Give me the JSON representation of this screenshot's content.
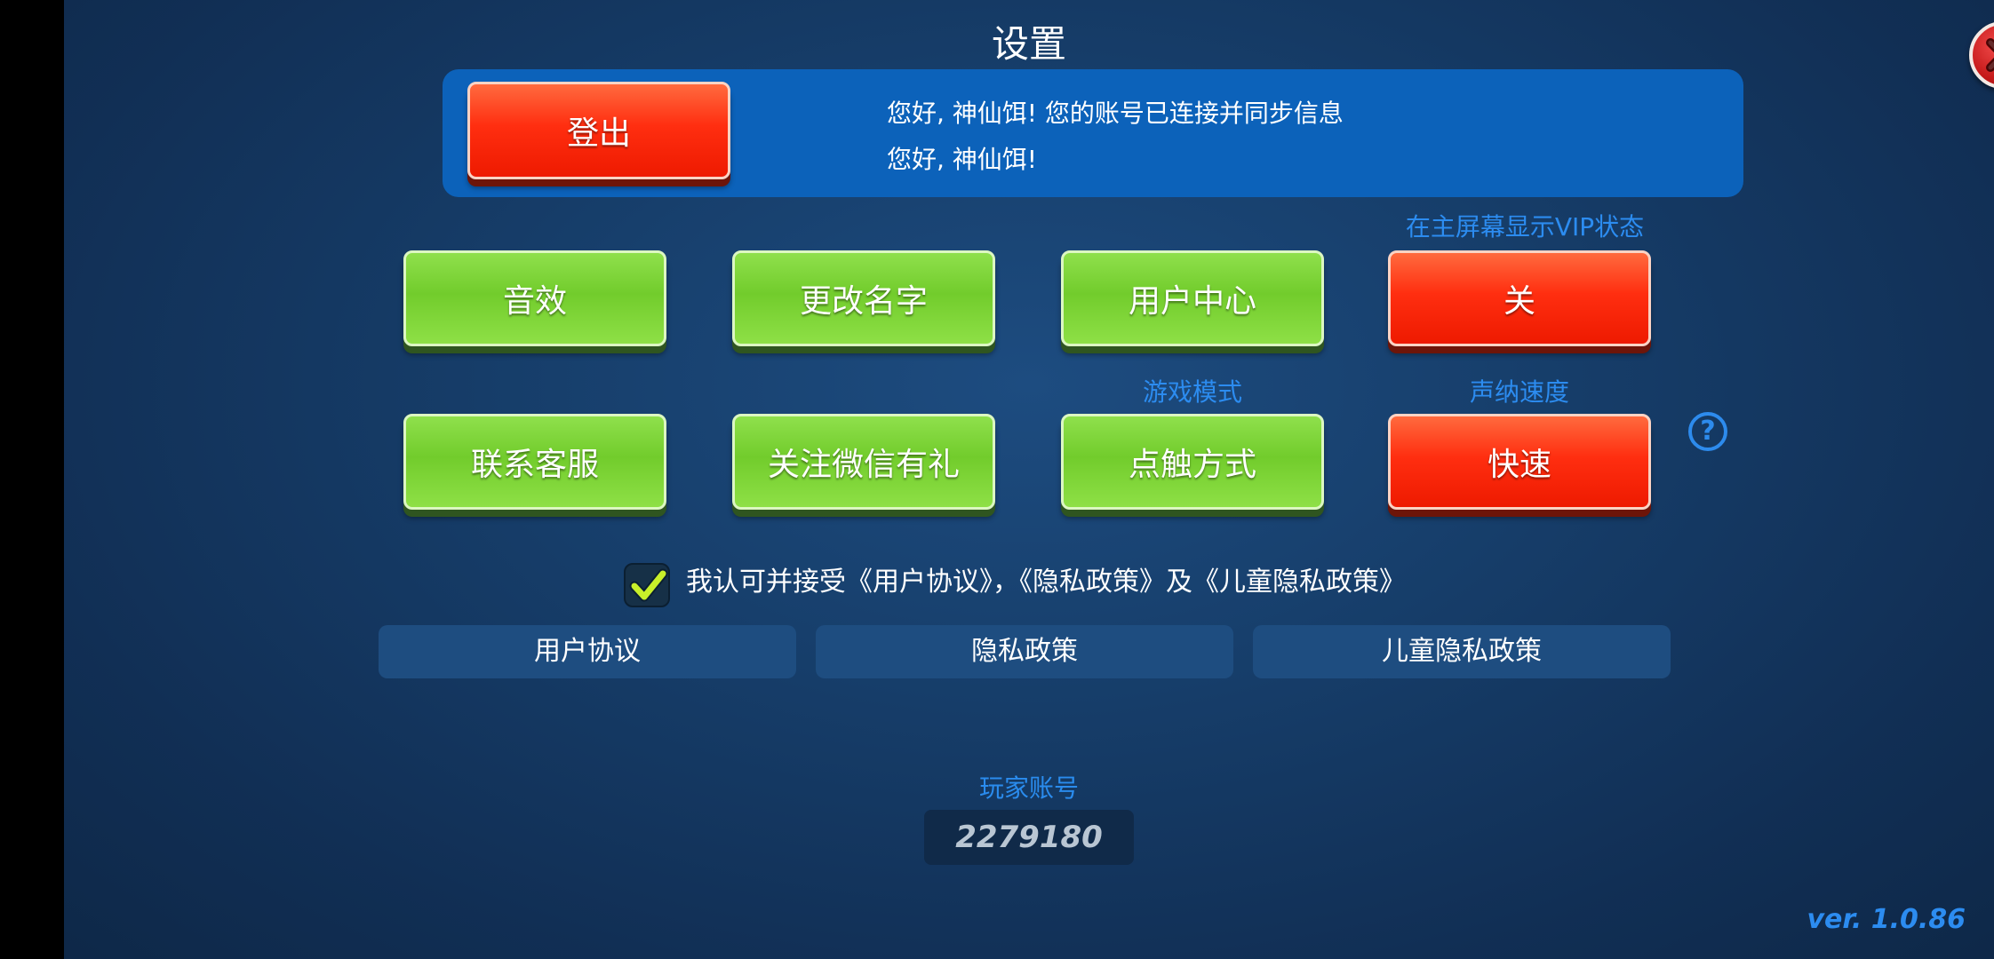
{
  "title": "设置",
  "close_icon": "close-icon",
  "account": {
    "logout_label": "登出",
    "line1": "您好, 神仙饵! 您的账号已连接并同步信息",
    "line2": "您好, 神仙饵!"
  },
  "labels": {
    "vip_status": "在主屏幕显示VIP状态",
    "game_mode": "游戏模式",
    "sonar_speed": "声纳速度"
  },
  "buttons": {
    "sound": "音效",
    "rename": "更改名字",
    "user_center": "用户中心",
    "vip_toggle": "关",
    "contact_service": "联系客服",
    "follow_wechat": "关注微信有礼",
    "touch_mode": "点触方式",
    "sonar_speed_value": "快速"
  },
  "help_icon": "question-mark-icon",
  "agreement": {
    "checked": true,
    "text": "我认可并接受《用户协议》，《隐私政策》及《儿童隐私政策》"
  },
  "policies": {
    "user_agreement": "用户协议",
    "privacy_policy": "隐私政策",
    "child_privacy_policy": "儿童隐私政策"
  },
  "player_account": {
    "label": "玩家账号",
    "value": "2279180"
  },
  "version": "ver. 1.0.86",
  "colors": {
    "background": "#163d69",
    "panel_blue": "#0c62ba",
    "button_red": "#ff2e10",
    "button_green": "#72cc2c",
    "label_blue": "#2c8cf0"
  }
}
